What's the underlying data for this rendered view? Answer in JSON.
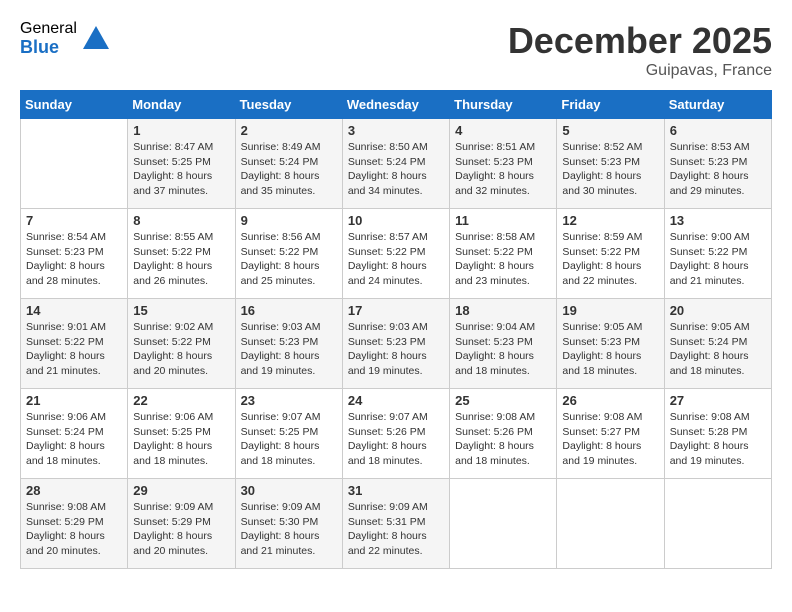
{
  "logo": {
    "general": "General",
    "blue": "Blue"
  },
  "header": {
    "month": "December 2025",
    "location": "Guipavas, France"
  },
  "days_of_week": [
    "Sunday",
    "Monday",
    "Tuesday",
    "Wednesday",
    "Thursday",
    "Friday",
    "Saturday"
  ],
  "weeks": [
    [
      {
        "num": "",
        "info": ""
      },
      {
        "num": "1",
        "info": "Sunrise: 8:47 AM\nSunset: 5:25 PM\nDaylight: 8 hours\nand 37 minutes."
      },
      {
        "num": "2",
        "info": "Sunrise: 8:49 AM\nSunset: 5:24 PM\nDaylight: 8 hours\nand 35 minutes."
      },
      {
        "num": "3",
        "info": "Sunrise: 8:50 AM\nSunset: 5:24 PM\nDaylight: 8 hours\nand 34 minutes."
      },
      {
        "num": "4",
        "info": "Sunrise: 8:51 AM\nSunset: 5:23 PM\nDaylight: 8 hours\nand 32 minutes."
      },
      {
        "num": "5",
        "info": "Sunrise: 8:52 AM\nSunset: 5:23 PM\nDaylight: 8 hours\nand 30 minutes."
      },
      {
        "num": "6",
        "info": "Sunrise: 8:53 AM\nSunset: 5:23 PM\nDaylight: 8 hours\nand 29 minutes."
      }
    ],
    [
      {
        "num": "7",
        "info": "Sunrise: 8:54 AM\nSunset: 5:23 PM\nDaylight: 8 hours\nand 28 minutes."
      },
      {
        "num": "8",
        "info": "Sunrise: 8:55 AM\nSunset: 5:22 PM\nDaylight: 8 hours\nand 26 minutes."
      },
      {
        "num": "9",
        "info": "Sunrise: 8:56 AM\nSunset: 5:22 PM\nDaylight: 8 hours\nand 25 minutes."
      },
      {
        "num": "10",
        "info": "Sunrise: 8:57 AM\nSunset: 5:22 PM\nDaylight: 8 hours\nand 24 minutes."
      },
      {
        "num": "11",
        "info": "Sunrise: 8:58 AM\nSunset: 5:22 PM\nDaylight: 8 hours\nand 23 minutes."
      },
      {
        "num": "12",
        "info": "Sunrise: 8:59 AM\nSunset: 5:22 PM\nDaylight: 8 hours\nand 22 minutes."
      },
      {
        "num": "13",
        "info": "Sunrise: 9:00 AM\nSunset: 5:22 PM\nDaylight: 8 hours\nand 21 minutes."
      }
    ],
    [
      {
        "num": "14",
        "info": "Sunrise: 9:01 AM\nSunset: 5:22 PM\nDaylight: 8 hours\nand 21 minutes."
      },
      {
        "num": "15",
        "info": "Sunrise: 9:02 AM\nSunset: 5:22 PM\nDaylight: 8 hours\nand 20 minutes."
      },
      {
        "num": "16",
        "info": "Sunrise: 9:03 AM\nSunset: 5:23 PM\nDaylight: 8 hours\nand 19 minutes."
      },
      {
        "num": "17",
        "info": "Sunrise: 9:03 AM\nSunset: 5:23 PM\nDaylight: 8 hours\nand 19 minutes."
      },
      {
        "num": "18",
        "info": "Sunrise: 9:04 AM\nSunset: 5:23 PM\nDaylight: 8 hours\nand 18 minutes."
      },
      {
        "num": "19",
        "info": "Sunrise: 9:05 AM\nSunset: 5:23 PM\nDaylight: 8 hours\nand 18 minutes."
      },
      {
        "num": "20",
        "info": "Sunrise: 9:05 AM\nSunset: 5:24 PM\nDaylight: 8 hours\nand 18 minutes."
      }
    ],
    [
      {
        "num": "21",
        "info": "Sunrise: 9:06 AM\nSunset: 5:24 PM\nDaylight: 8 hours\nand 18 minutes."
      },
      {
        "num": "22",
        "info": "Sunrise: 9:06 AM\nSunset: 5:25 PM\nDaylight: 8 hours\nand 18 minutes."
      },
      {
        "num": "23",
        "info": "Sunrise: 9:07 AM\nSunset: 5:25 PM\nDaylight: 8 hours\nand 18 minutes."
      },
      {
        "num": "24",
        "info": "Sunrise: 9:07 AM\nSunset: 5:26 PM\nDaylight: 8 hours\nand 18 minutes."
      },
      {
        "num": "25",
        "info": "Sunrise: 9:08 AM\nSunset: 5:26 PM\nDaylight: 8 hours\nand 18 minutes."
      },
      {
        "num": "26",
        "info": "Sunrise: 9:08 AM\nSunset: 5:27 PM\nDaylight: 8 hours\nand 19 minutes."
      },
      {
        "num": "27",
        "info": "Sunrise: 9:08 AM\nSunset: 5:28 PM\nDaylight: 8 hours\nand 19 minutes."
      }
    ],
    [
      {
        "num": "28",
        "info": "Sunrise: 9:08 AM\nSunset: 5:29 PM\nDaylight: 8 hours\nand 20 minutes."
      },
      {
        "num": "29",
        "info": "Sunrise: 9:09 AM\nSunset: 5:29 PM\nDaylight: 8 hours\nand 20 minutes."
      },
      {
        "num": "30",
        "info": "Sunrise: 9:09 AM\nSunset: 5:30 PM\nDaylight: 8 hours\nand 21 minutes."
      },
      {
        "num": "31",
        "info": "Sunrise: 9:09 AM\nSunset: 5:31 PM\nDaylight: 8 hours\nand 22 minutes."
      },
      {
        "num": "",
        "info": ""
      },
      {
        "num": "",
        "info": ""
      },
      {
        "num": "",
        "info": ""
      }
    ]
  ]
}
